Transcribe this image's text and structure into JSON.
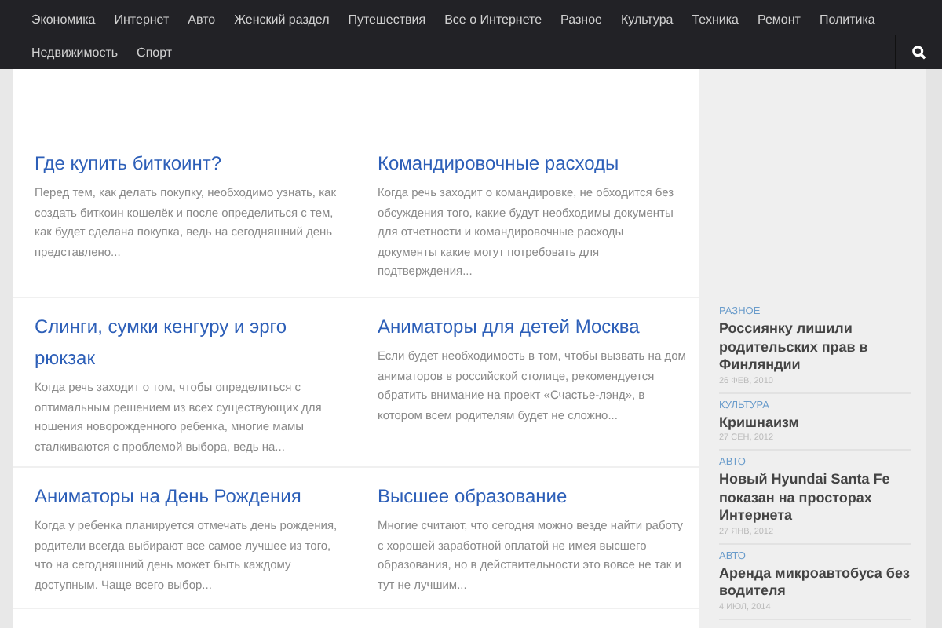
{
  "nav": {
    "items": [
      "Экономика",
      "Интернет",
      "Авто",
      "Женский раздел",
      "Путешествия",
      "Все о Интернете",
      "Разное",
      "Культура",
      "Техника",
      "Ремонт",
      "Политика",
      "Недвижимость",
      "Спорт"
    ]
  },
  "articles": [
    {
      "title": "Где купить биткоинт?",
      "excerpt": "Перед тем, как делать покупку, необходимо узнать, как создать биткоин кошелёк и после определиться с тем, как будет сделана покупка, ведь на сегодняшний день представлено..."
    },
    {
      "title": "Командировочные расходы",
      "excerpt": "Когда речь заходит о командировке, не обходится без обсуждения того, какие будут необходимы документы для отчетности и командировочные расходы документы какие могут потребовать для подтверждения..."
    },
    {
      "title": "Слинги, сумки кенгуру и эрго рюкзак",
      "excerpt": "Когда речь заходит о том, чтобы определиться с оптимальным решением из всех существующих для ношения новорожденного ребенка, многие мамы сталкиваются с проблемой выбора, ведь на..."
    },
    {
      "title": "Аниматоры для детей Москва",
      "excerpt": "Если будет необходимость в том, чтобы вызвать на дом аниматоров в российской столице, рекомендуется обратить внимание на проект «Счастье-лэнд», в котором всем родителям будет не сложно..."
    },
    {
      "title": "Аниматоры на День Рождения",
      "excerpt": "Когда у ребенка планируется отмечать день рождения, родители всегда выбирают все самое лучшее из того, что на сегодняшний день может быть каждому доступным. Чаще всего выбор..."
    },
    {
      "title": "Высшее образование",
      "excerpt": "Многие считают, что сегодня можно везде найти работу с хорошей заработной оплатой не имея высшего образования, но в действительности это вовсе не так и тут не лучшим..."
    }
  ],
  "sidebar": {
    "posts": [
      {
        "category": "РАЗНОЕ",
        "title": "Россиянку лишили родительских прав в Финляндии",
        "date": "26 ФЕВ, 2010"
      },
      {
        "category": "КУЛЬТУРА",
        "title": "Кришнаизм",
        "date": "27 СЕН, 2012"
      },
      {
        "category": "АВТО",
        "title": "Новый Hyundai Santa Fe показан на просторах Интернета",
        "date": "27 ЯНВ, 2012"
      },
      {
        "category": "АВТО",
        "title": "Аренда микроавтобуса без водителя",
        "date": "4 ИЮЛ, 2014"
      }
    ]
  }
}
